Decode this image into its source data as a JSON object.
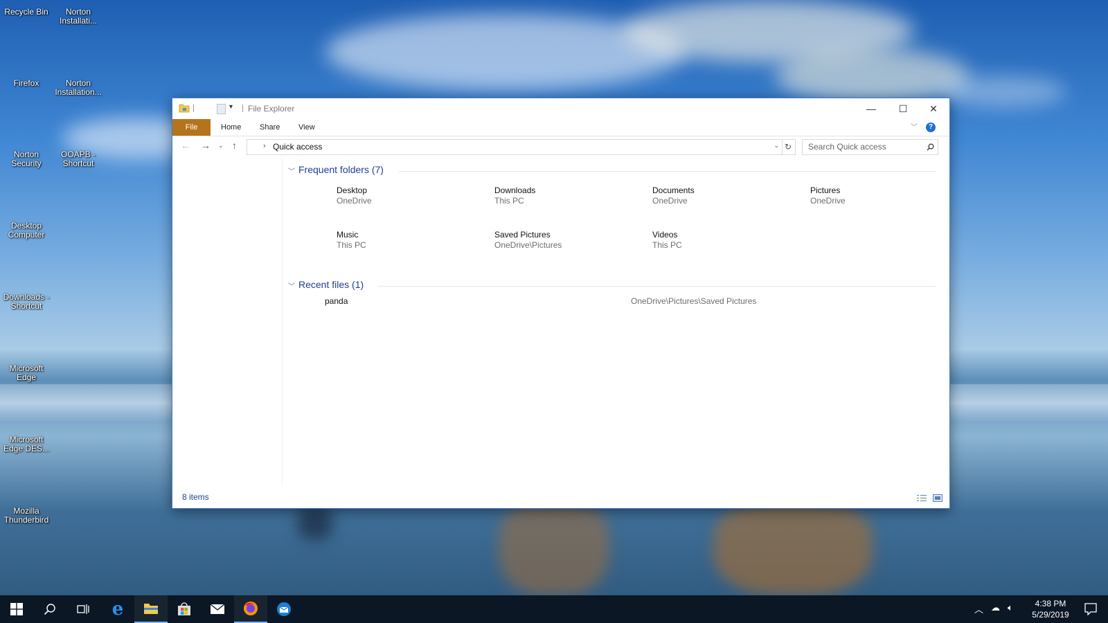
{
  "desktop": {
    "icons": [
      {
        "label": "Recycle Bin"
      },
      {
        "label": "Norton Installati..."
      },
      {
        "label": "Firefox"
      },
      {
        "label": "Norton Installation..."
      },
      {
        "label": "Norton Security"
      },
      {
        "label": "OOAPB - Shortcut"
      },
      {
        "label": "Desktop Computer"
      },
      {
        "label": "Downloads - Shortcut"
      },
      {
        "label": "Microsoft Edge"
      },
      {
        "label": "Microsoft Edge DES..."
      },
      {
        "label": "Mozilla Thunderbird"
      }
    ]
  },
  "window": {
    "title": "File Explorer",
    "ribbon": {
      "file": "File",
      "home": "Home",
      "share": "Share",
      "view": "View",
      "help": "?"
    },
    "address": "Quick access",
    "search_placeholder": "Search Quick access",
    "frequent": {
      "title": "Frequent folders (7)",
      "folders": [
        {
          "name": "Desktop",
          "location": "OneDrive"
        },
        {
          "name": "Downloads",
          "location": "This PC"
        },
        {
          "name": "Documents",
          "location": "OneDrive"
        },
        {
          "name": "Pictures",
          "location": "OneDrive"
        },
        {
          "name": "Music",
          "location": "This PC"
        },
        {
          "name": "Saved Pictures",
          "location": "OneDrive\\Pictures"
        },
        {
          "name": "Videos",
          "location": "This PC"
        }
      ]
    },
    "recent": {
      "title": "Recent files (1)",
      "files": [
        {
          "name": "panda",
          "path": "OneDrive\\Pictures\\Saved Pictures"
        }
      ]
    },
    "status": "8 items"
  },
  "taskbar": {
    "time": "4:38 PM",
    "date": "5/29/2019",
    "accent": "#7fb4f2"
  },
  "colors": {
    "ribbon_file": "#b5741c",
    "group_title": "#1e3f8f",
    "help": "#1f6fd1"
  }
}
